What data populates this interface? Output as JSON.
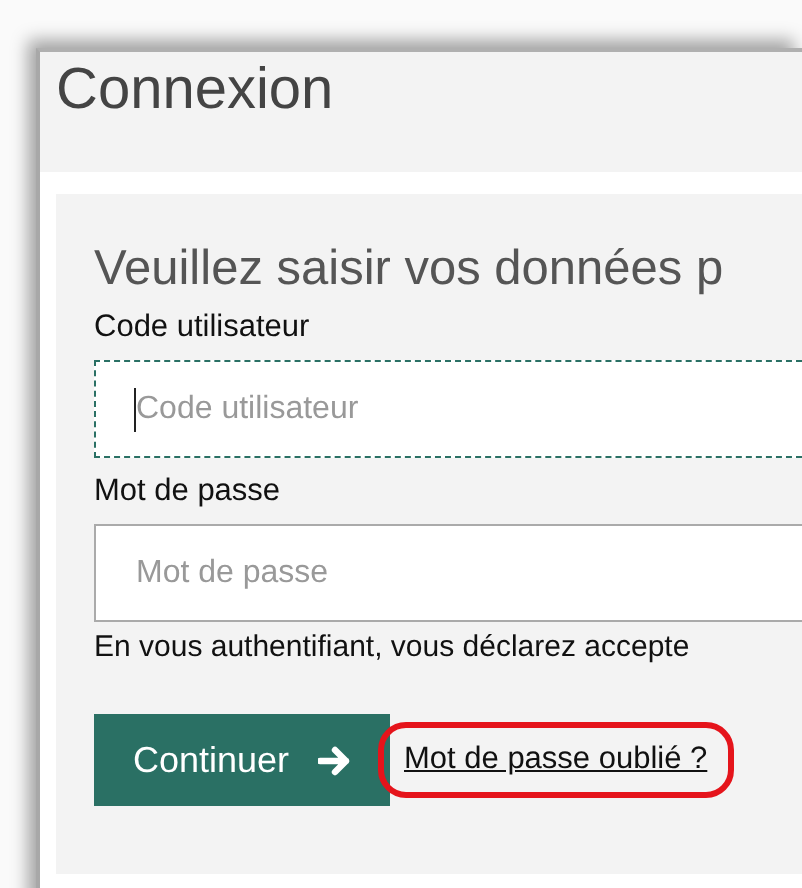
{
  "window": {
    "title": "Connexion"
  },
  "form": {
    "heading": "Veuillez saisir vos données p",
    "fields": [
      {
        "label": "Code utilisateur",
        "placeholder": "Code utilisateur",
        "focused": true
      },
      {
        "label": "Mot de passe",
        "placeholder": "Mot de passe",
        "focused": false
      }
    ],
    "notice": "En vous authentifiant, vous déclarez accepte",
    "submit": {
      "label": "Continuer"
    },
    "forgot_link": {
      "label": "Mot de passe oublié ?",
      "highlighted": true
    }
  }
}
